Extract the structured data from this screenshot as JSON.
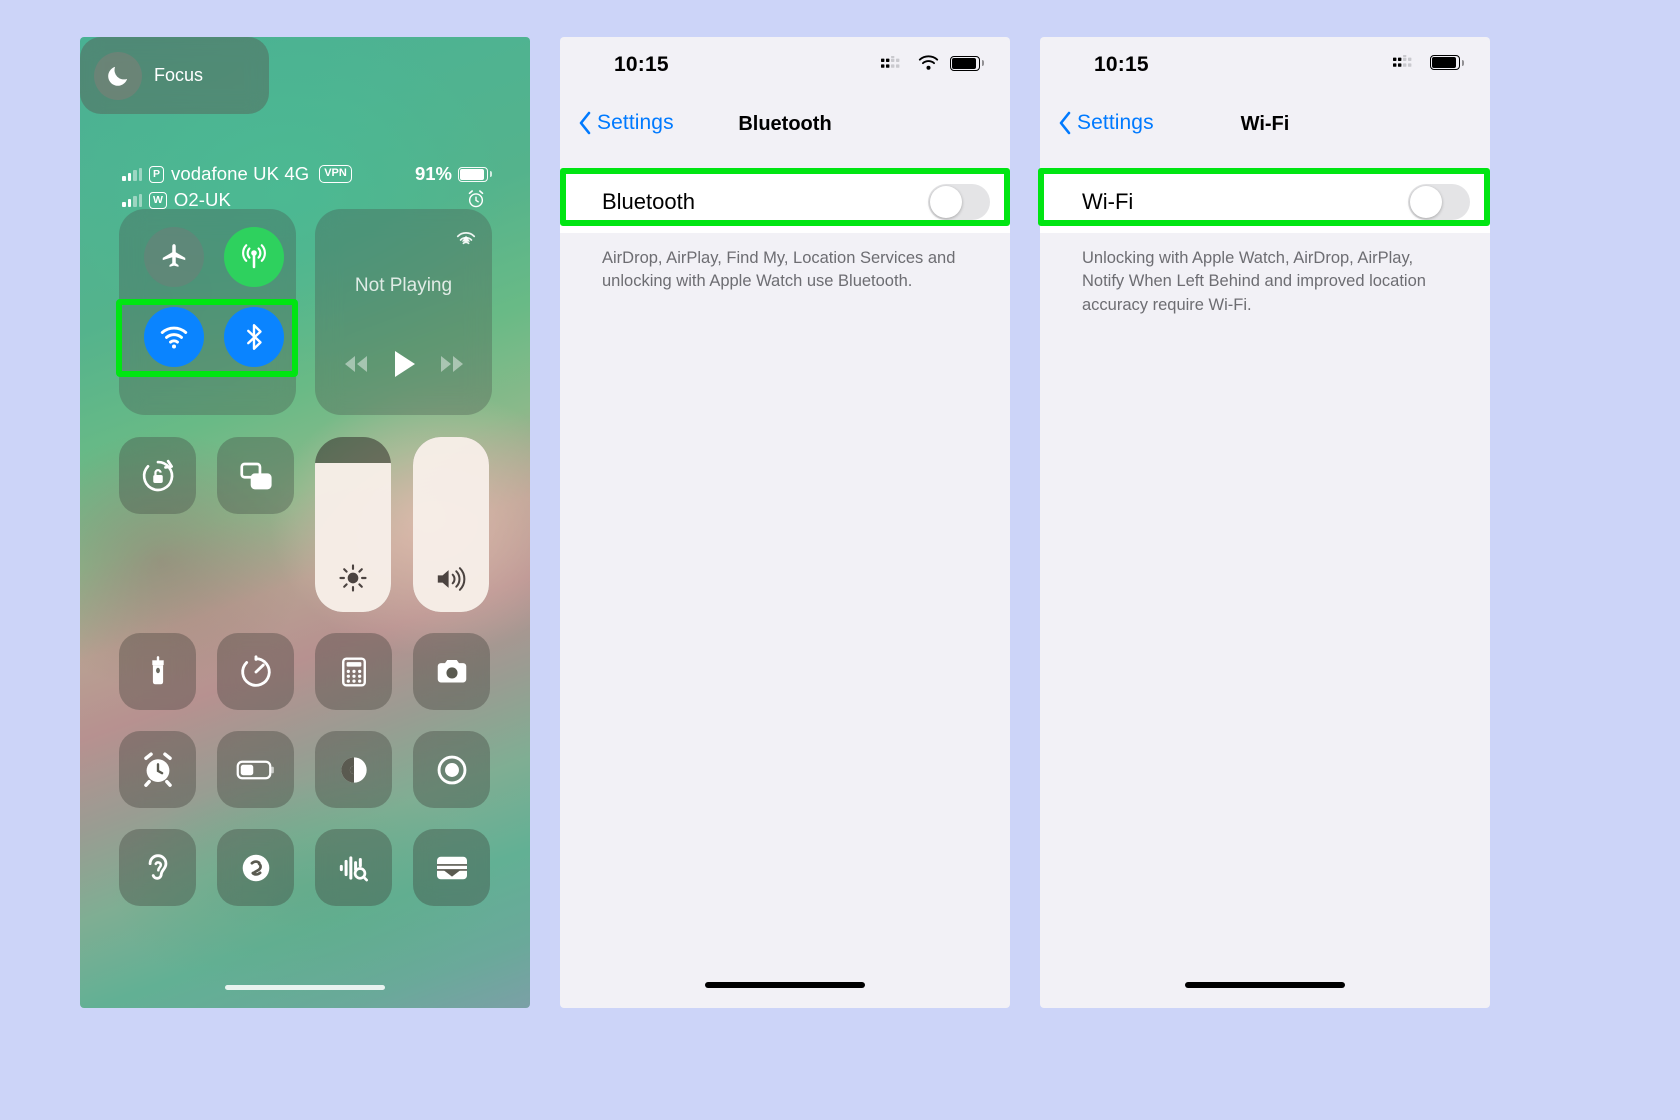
{
  "page": {
    "background_color": "#ccd4f8",
    "highlight_color": "#00e512"
  },
  "control_center": {
    "status_bar": {
      "sim1": {
        "carrier": "vodafone UK 4G",
        "sim_badge": "P",
        "vpn_badge": "VPN"
      },
      "sim2": {
        "carrier": "O2-UK",
        "sim_badge": "W"
      },
      "battery_percent": "91%",
      "alarm_icon": "alarm-clock-icon"
    },
    "connectivity": {
      "airplane": {
        "name": "airplane-mode-toggle",
        "state": "off"
      },
      "cellular": {
        "name": "cellular-data-toggle",
        "state": "on",
        "color": "#2ed15e"
      },
      "wifi": {
        "name": "wifi-toggle",
        "state": "on",
        "color": "#0a84ff"
      },
      "bluetooth": {
        "name": "bluetooth-toggle",
        "state": "on",
        "color": "#0a84ff"
      }
    },
    "media": {
      "title": "Not Playing",
      "airplay_icon": "airplay-icon",
      "controls": [
        "rewind-icon",
        "play-icon",
        "fast-forward-icon"
      ]
    },
    "tiles": {
      "rotation_lock": "rotation-lock-icon",
      "screen_mirroring": "screen-mirroring-icon",
      "focus_label": "Focus"
    },
    "sliders": {
      "brightness": {
        "label": "brightness-slider",
        "value": 85
      },
      "volume": {
        "label": "volume-slider",
        "value": 100
      }
    },
    "grid": [
      {
        "name": "flashlight-icon"
      },
      {
        "name": "timer-icon"
      },
      {
        "name": "calculator-icon"
      },
      {
        "name": "camera-icon"
      },
      {
        "name": "alarm-icon"
      },
      {
        "name": "low-power-mode-icon"
      },
      {
        "name": "dark-mode-icon"
      },
      {
        "name": "screen-record-icon"
      },
      {
        "name": "hearing-icon"
      },
      {
        "name": "shazam-icon"
      },
      {
        "name": "sound-recognition-icon"
      },
      {
        "name": "wallet-icon"
      }
    ]
  },
  "bluetooth_screen": {
    "status_bar": {
      "time": "10:15",
      "signal_icon": "cellular-signal-icon",
      "wifi_icon": "wifi-icon",
      "battery_icon": "battery-icon"
    },
    "nav": {
      "back_label": "Settings",
      "title": "Bluetooth"
    },
    "row": {
      "label": "Bluetooth",
      "toggle_state": "off"
    },
    "footer": "AirDrop, AirPlay, Find My, Location Services and unlocking with Apple Watch use Bluetooth."
  },
  "wifi_screen": {
    "status_bar": {
      "time": "10:15",
      "signal_icon": "cellular-signal-icon",
      "battery_icon": "battery-icon"
    },
    "nav": {
      "back_label": "Settings",
      "title": "Wi-Fi"
    },
    "row": {
      "label": "Wi-Fi",
      "toggle_state": "off"
    },
    "footer": "Unlocking with Apple Watch, AirDrop, AirPlay, Notify When Left Behind and improved location accuracy require Wi-Fi."
  }
}
